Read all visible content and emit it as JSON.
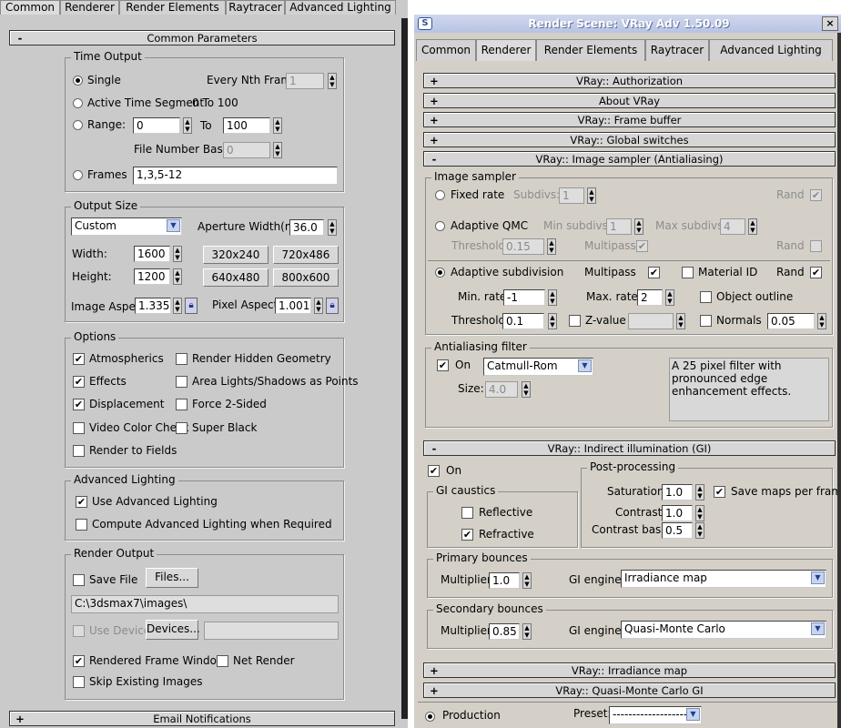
{
  "left": {
    "tabs": [
      "Common",
      "Renderer",
      "Render Elements",
      "Raytracer",
      "Advanced Lighting"
    ],
    "common_params": {
      "sign": "-",
      "title": "Common Parameters"
    },
    "time_output": {
      "title": "Time Output",
      "single": "Single",
      "every_nth_label": "Every Nth Frame:",
      "every_nth_value": "1",
      "active_segment": "Active Time Segment:",
      "active_segment_value": "0 To 100",
      "range": "Range:",
      "range_from": "0",
      "to_label": "To",
      "range_to": "100",
      "file_number_base_label": "File Number Base:",
      "file_number_base_value": "0",
      "frames": "Frames",
      "frames_value": "1,3,5-12"
    },
    "output_size": {
      "title": "Output Size",
      "preset": "Custom",
      "aperture_label": "Aperture Width(mm):",
      "aperture_value": "36.0",
      "width_label": "Width:",
      "width_value": "1600",
      "height_label": "Height:",
      "height_value": "1200",
      "presets": [
        "320x240",
        "720x486",
        "640x480",
        "800x600"
      ],
      "image_aspect_label": "Image Aspect:",
      "image_aspect_value": "1.335",
      "pixel_aspect_label": "Pixel Aspect:",
      "pixel_aspect_value": "1.001"
    },
    "options": {
      "title": "Options",
      "items": [
        "Atmospherics",
        "Render Hidden Geometry",
        "Effects",
        "Area Lights/Shadows as Points",
        "Displacement",
        "Force 2-Sided",
        "Video Color Check",
        "Super Black",
        "Render to Fields"
      ]
    },
    "advanced_lighting": {
      "title": "Advanced Lighting",
      "use": "Use Advanced Lighting",
      "compute": "Compute Advanced Lighting when Required"
    },
    "render_output": {
      "title": "Render Output",
      "save_file": "Save File",
      "files_button": "Files...",
      "path": "C:\\3dsmax7\\images\\",
      "use_device": "Use Device",
      "devices_button": "Devices...",
      "rendered_frame_window": "Rendered Frame Window",
      "net_render": "Net Render",
      "skip_existing": "Skip Existing Images"
    },
    "email": {
      "sign": "+",
      "title": "Email Notifications"
    }
  },
  "right": {
    "window_title": "Render Scene: VRay Adv 1.50.09",
    "close": "×",
    "app_icon": "S",
    "tabs": [
      "Common",
      "Renderer",
      "Render Elements",
      "Raytracer",
      "Advanced Lighting"
    ],
    "rollouts_top": [
      {
        "sign": "+",
        "title": "VRay:: Authorization"
      },
      {
        "sign": "+",
        "title": "About VRay"
      },
      {
        "sign": "+",
        "title": "VRay:: Frame buffer"
      },
      {
        "sign": "+",
        "title": "VRay:: Global switches"
      },
      {
        "sign": "-",
        "title": "VRay:: Image sampler (Antialiasing)"
      }
    ],
    "image_sampler": {
      "title": "Image sampler",
      "fixed_rate": "Fixed rate",
      "subdivs_label": "Subdivs:",
      "subdivs_value": "1",
      "rand": "Rand",
      "adaptive_qmc": "Adaptive QMC",
      "min_subdivs_label": "Min subdivs:",
      "min_subdivs_value": "1",
      "max_subdivs_label": "Max subdivs:",
      "max_subdivs_value": "4",
      "threshold_label": "Threshold:",
      "qmc_threshold_value": "0.15",
      "multipass": "Multipass",
      "adaptive_subdivision": "Adaptive subdivision",
      "material_id": "Material ID",
      "min_rate_label": "Min. rate:",
      "min_rate_value": "-1",
      "max_rate_label": "Max. rate:",
      "max_rate_value": "2",
      "object_outline": "Object outline",
      "threshold_value": "0.1",
      "z_value": "Z-value",
      "normals": "Normals",
      "normals_value": "0.05"
    },
    "aa_filter": {
      "title": "Antialiasing filter",
      "on": "On",
      "filter": "Catmull-Rom",
      "description": "A 25 pixel filter with pronounced edge enhancement effects.",
      "size_label": "Size:",
      "size_value": "4.0"
    },
    "gi_rollout": {
      "sign": "-",
      "title": "VRay:: Indirect illumination (GI)"
    },
    "gi": {
      "on": "On",
      "caustics_title": "GI caustics",
      "reflective": "Reflective",
      "refractive": "Refractive",
      "post_title": "Post-processing",
      "saturation_label": "Saturation:",
      "saturation_value": "1.0",
      "save_maps": "Save maps per frame",
      "contrast_label": "Contrast:",
      "contrast_value": "1.0",
      "contrast_base_label": "Contrast base:",
      "contrast_base_value": "0.5",
      "primary_title": "Primary bounces",
      "multiplier_label": "Multiplier:",
      "primary_multiplier": "1.0",
      "gi_engine_label": "GI engine:",
      "primary_engine": "Irradiance map",
      "secondary_title": "Secondary bounces",
      "secondary_multiplier": "0.85",
      "secondary_engine": "Quasi-Monte Carlo"
    },
    "rollouts_bottom": [
      {
        "sign": "+",
        "title": "VRay:: Irradiance map"
      },
      {
        "sign": "+",
        "title": "VRay:: Quasi-Monte Carlo GI"
      }
    ],
    "footer": {
      "production": "Production",
      "preset_label": "Preset:",
      "preset_value": "--------------------"
    }
  }
}
